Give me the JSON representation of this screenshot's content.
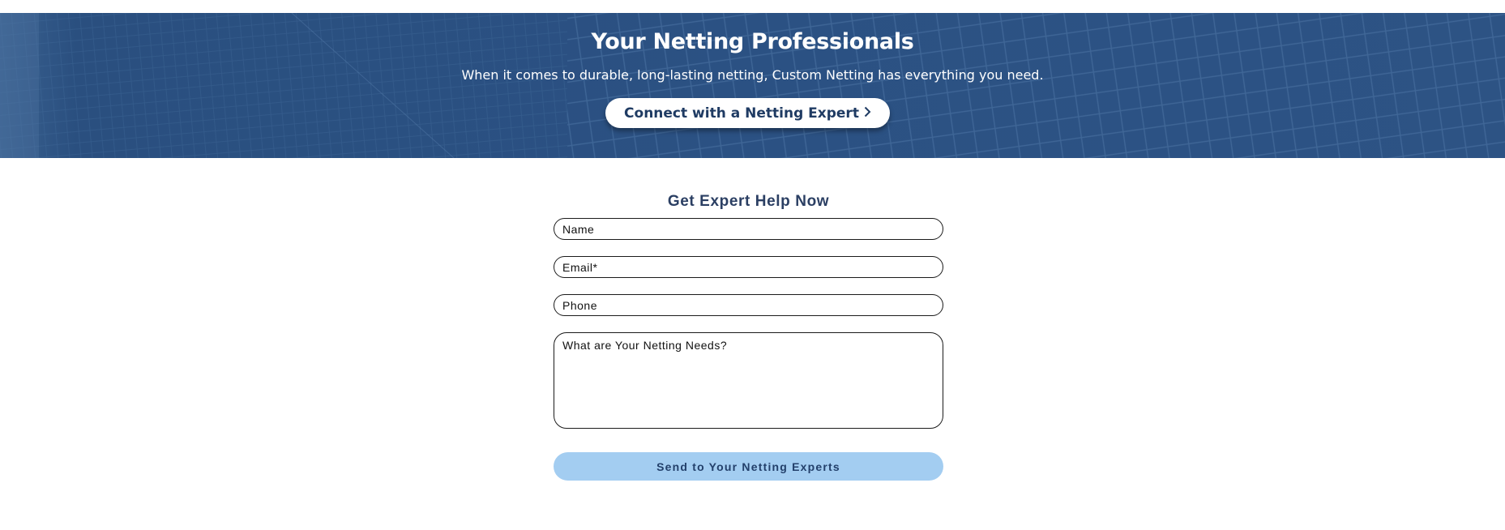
{
  "hero": {
    "title": "Your Netting Professionals",
    "subtitle": "When it comes to durable, long-lasting netting, Custom Netting has everything you need.",
    "cta_label": "Connect with a Netting Expert",
    "cta_icon": "chevron-right-icon",
    "background_color": "#2c5283"
  },
  "form": {
    "title": "Get Expert Help Now",
    "name_placeholder": "Name",
    "email_placeholder": "Email*",
    "phone_placeholder": "Phone",
    "message_placeholder": "What are Your Netting Needs?",
    "submit_label": "Send to Your Netting Experts",
    "submit_color": "#a3cdf1"
  }
}
